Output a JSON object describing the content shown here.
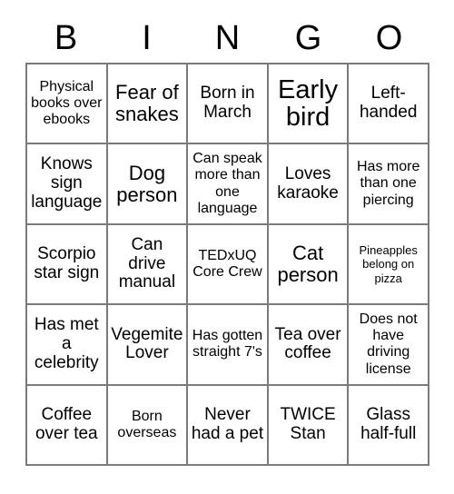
{
  "card": {
    "title": "BINGO",
    "header_letters": [
      "B",
      "I",
      "N",
      "G",
      "O"
    ],
    "grid_size": "5x5",
    "colors": {
      "background": "#ffffff",
      "text": "#000000",
      "grid_line": "#7a7a7a"
    },
    "rows": [
      [
        {
          "text": "Physical books over ebooks",
          "size": "t-sm"
        },
        {
          "text": "Fear of snakes",
          "size": "t-lg"
        },
        {
          "text": "Born in March",
          "size": "t-md"
        },
        {
          "text": "Early bird",
          "size": "t-xl"
        },
        {
          "text": "Left-handed",
          "size": "t-md"
        }
      ],
      [
        {
          "text": "Knows sign language",
          "size": "t-md"
        },
        {
          "text": "Dog person",
          "size": "t-lg"
        },
        {
          "text": "Can speak more than one language",
          "size": "t-sm"
        },
        {
          "text": "Loves karaoke",
          "size": "t-md"
        },
        {
          "text": "Has more than one piercing",
          "size": "t-sm"
        }
      ],
      [
        {
          "text": "Scorpio star sign",
          "size": "t-md"
        },
        {
          "text": "Can drive manual",
          "size": "t-md"
        },
        {
          "text": "TEDxUQ Core Crew",
          "size": "t-sm"
        },
        {
          "text": "Cat person",
          "size": "t-lg"
        },
        {
          "text": "Pineapples belong on pizza",
          "size": "t-xs"
        }
      ],
      [
        {
          "text": "Has met a celebrity",
          "size": "t-md"
        },
        {
          "text": "Vegemite Lover",
          "size": "t-md"
        },
        {
          "text": "Has gotten straight 7's",
          "size": "t-sm"
        },
        {
          "text": "Tea over coffee",
          "size": "t-md"
        },
        {
          "text": "Does not have driving license",
          "size": "t-sm"
        }
      ],
      [
        {
          "text": "Coffee over tea",
          "size": "t-md"
        },
        {
          "text": "Born overseas",
          "size": "t-sm"
        },
        {
          "text": "Never had a pet",
          "size": "t-md"
        },
        {
          "text": "TWICE Stan",
          "size": "t-md"
        },
        {
          "text": "Glass half-full",
          "size": "t-md"
        }
      ]
    ]
  }
}
